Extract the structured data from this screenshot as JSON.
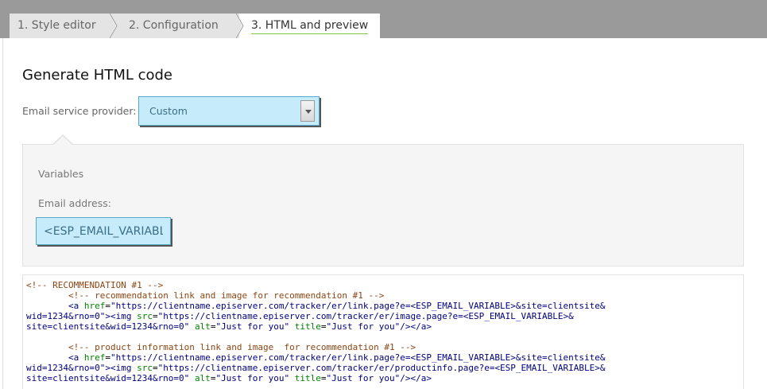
{
  "tabs": [
    {
      "label": "1. Style editor",
      "active": false
    },
    {
      "label": "2. Configuration",
      "active": false
    },
    {
      "label": "3. HTML and preview",
      "active": true
    }
  ],
  "main": {
    "title": "Generate HTML code",
    "esp_label": "Email service provider:",
    "esp_selected": "Custom",
    "variables_title": "Variables",
    "email_label": "Email address:",
    "email_value": "<ESP_EMAIL_VARIABLE>"
  },
  "code": {
    "rec_comment": "<!-- RECOMMENDATION #1 -->",
    "block1_comment": "<!-- recommendation link and image for recommendation #1 -->",
    "block1_href_1": "\"https://clientname.episerver.com/tracker/er/link.page?e=<ESP_EMAIL_VARIABLE>&site=clientsite&",
    "block1_href_2": "wid=1234&rno=0\"",
    "block1_src_1": "\"https://clientname.episerver.com/tracker/er/image.page?e=<ESP_EMAIL_VARIABLE>&",
    "block1_src_2": "site=clientsite&wid=1234&rno=0\"",
    "alt_value": "\"Just for you\"",
    "title_value": "\"Just for you\"",
    "block2_comment": "<!-- product information link and image  for recommendation #1 -->",
    "block2_href_1": "\"https://clientname.episerver.com/tracker/er/link.page?e=<ESP_EMAIL_VARIABLE>&site=clientsite&",
    "block2_href_2": "wid=1234&rno=0\"",
    "block2_src_1": "\"https://clientname.episerver.com/tracker/er/productinfo.page?e=<ESP_EMAIL_VARIABLE>&",
    "block2_src_2": "site=clientsite&wid=1234&rno=0\""
  }
}
